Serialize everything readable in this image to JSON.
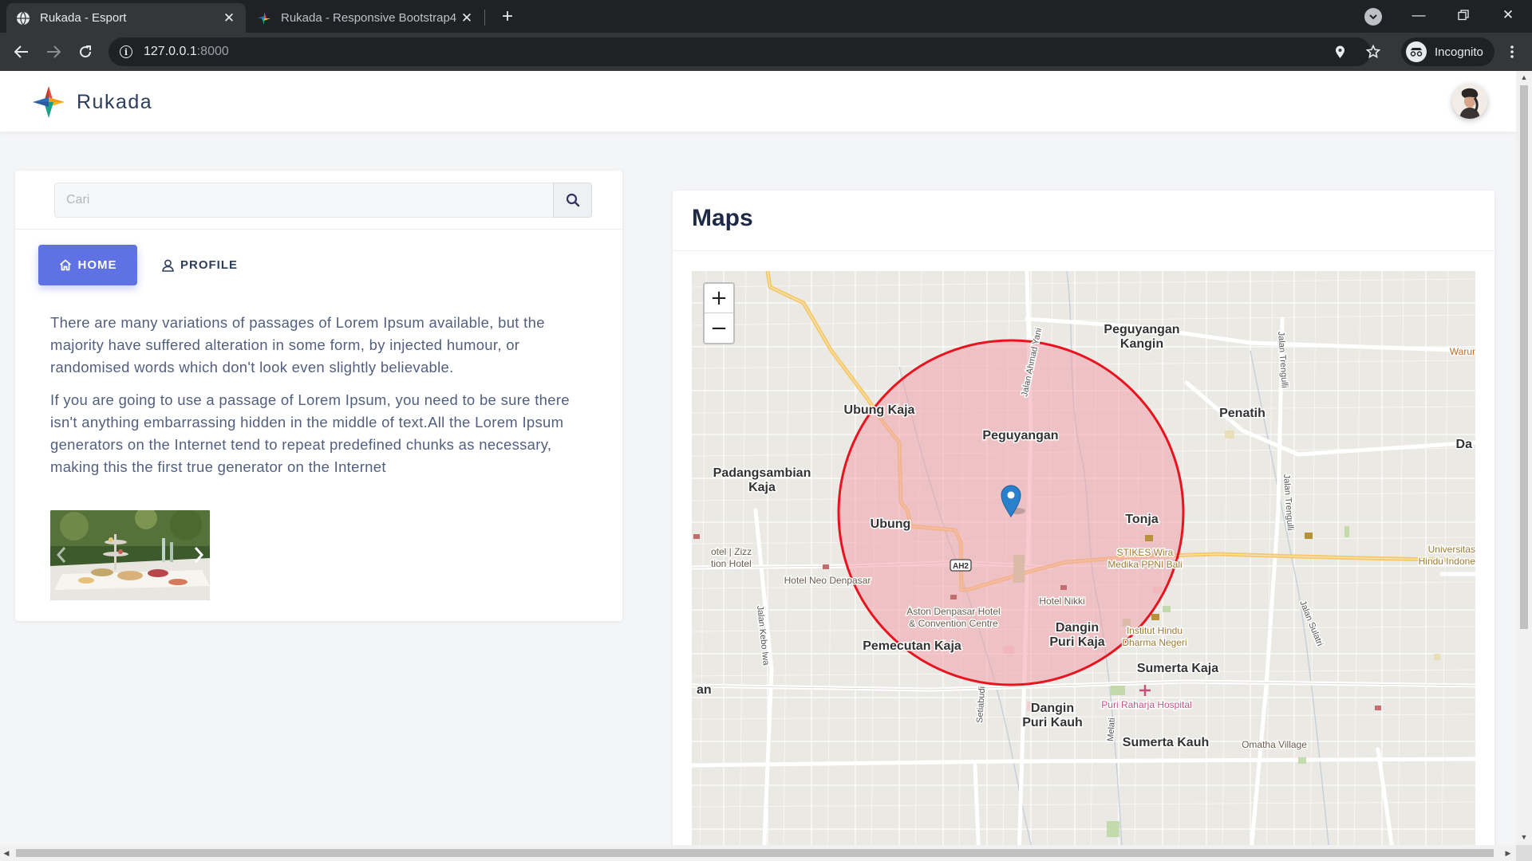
{
  "browser": {
    "tabs": [
      {
        "title": "Rukada - Esport",
        "active": true,
        "favicon": "globe-icon"
      },
      {
        "title": "Rukada - Responsive Bootstrap4",
        "active": false,
        "favicon": "rukada-logo-icon"
      }
    ],
    "url_host": "127.0.0.1",
    "url_port": ":8000",
    "incognito_label": "Incognito"
  },
  "navbar": {
    "brand_name": "Rukada",
    "logo_colors": [
      "#e84c3d",
      "#f5b21b",
      "#1e9e8f",
      "#2f6ab8"
    ]
  },
  "search": {
    "placeholder": "Cari",
    "icon": "search-icon"
  },
  "tabs": {
    "home_label": "HOME",
    "profile_label": "PROFILE",
    "active": "home"
  },
  "content": {
    "paragraph1": "There are many variations of passages of Lorem Ipsum available, but the majority have suffered alteration in some form, by injected humour, or randomised words which don't look even slightly believable.",
    "paragraph2": "If you are going to use a passage of Lorem Ipsum, you need to be sure there isn't anything embarrassing hidden in the middle of text.All the Lorem Ipsum generators on the Internet tend to repeat predefined chunks as necessary, making this the first true generator on the Internet"
  },
  "maps": {
    "title": "Maps",
    "zoom_in": "+",
    "zoom_out": "−",
    "circle_color": "#e8131f",
    "circle_fill": "#f1a0aa",
    "marker_color": "#2a81cb",
    "labels": {
      "peguyangan_kangin_1": "Peguyangan",
      "peguyangan_kangin_2": "Kangin",
      "ubung_kaja": "Ubung Kaja",
      "penatih": "Penatih",
      "peguyangan": "Peguyangan",
      "padangsambian_1": "Padangsambian",
      "padangsambian_2": "Kaja",
      "ubung": "Ubung",
      "tonja": "Tonja",
      "hotel_izzi_1": "otel | Zizz",
      "hotel_izzi_2": "tion Hotel",
      "hotel_neo": "Hotel Neo Denpasar",
      "stikes_1": "STIKES Wira",
      "stikes_2": "Medika PPNI Bali",
      "universitas_1": "Universitas",
      "universitas_2": "Hindu Indone",
      "ah2": "AH2",
      "aston_1": "Aston Denpasar Hotel",
      "aston_2": "& Convention Centre",
      "hotel_nikki": "Hotel Nikki",
      "dangin_puri_kaja_1": "Dangin",
      "dangin_puri_kaja_2": "Puri Kaja",
      "institut_1": "Institut Hindu",
      "institut_2": "Dharma Negeri",
      "pemecutan_kaja": "Pemecutan Kaja",
      "sumerta_kaja": "Sumerta Kaja",
      "dangin_puri_kauh_1": "Dangin",
      "dangin_puri_kauh_2": "Puri Kauh",
      "puri_raharja": "Puri Raharja Hospital",
      "omatha": "Omatha Village",
      "sumerta_kauh": "Sumerta Kauh",
      "jalan_ahmad_yani": "Jalan Ahmad Yani",
      "jalan_trenggli_1": "Jalan Trengulli",
      "jalan_trenggli_2": "Jalan Trengulli",
      "jalan_kebo_iwa": "Jalan Kebo Iwa",
      "jalan_sulatri": "Jalan Sulatri",
      "setiabudi": "Setiabudi",
      "melati": "Melati",
      "warung": "Warur",
      "da": "Da",
      "an": "an"
    }
  }
}
